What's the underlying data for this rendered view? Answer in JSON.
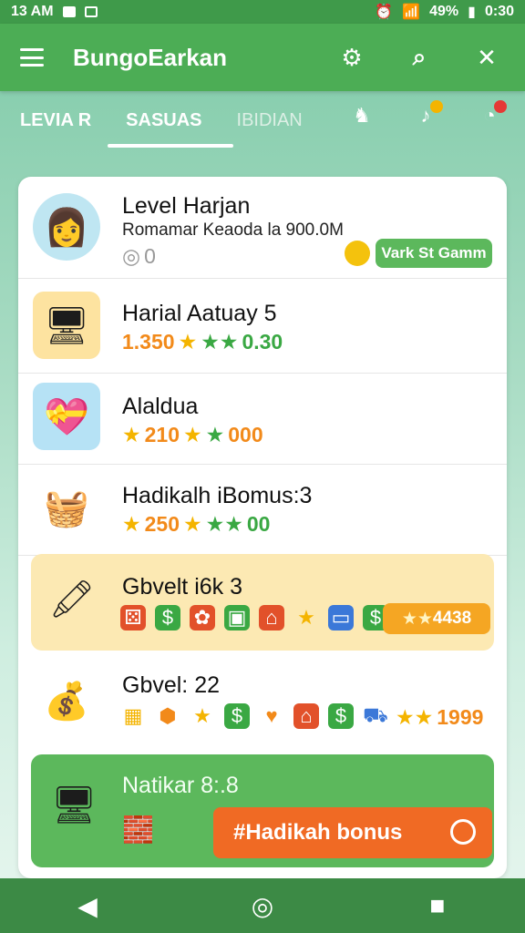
{
  "status": {
    "time_left": "13 AM",
    "battery": "49%",
    "clock": "0:30"
  },
  "app": {
    "title": "BungoEarkan"
  },
  "toolbar": {
    "settings_icon": "gear-icon",
    "search_icon": "search-icon",
    "close_icon": "close-icon"
  },
  "tabs": [
    {
      "label": "LEVIA R"
    },
    {
      "label": "SASUAS"
    },
    {
      "label": "IBIDIAN"
    }
  ],
  "rows": [
    {
      "title": "Level Harjan",
      "subtitle": "Romamar Keaoda la 900.0M",
      "stat": "0",
      "action": "Vark St Gamm"
    },
    {
      "title": "Harial Aatuay 5",
      "stat_a": "1.350",
      "stat_b": "0.30"
    },
    {
      "title": "Alaldua",
      "stat_a": "210",
      "stat_b": "000"
    },
    {
      "title": "Hadikalh iBomus:3",
      "stat_a": "250",
      "stat_b": "00"
    },
    {
      "title": "Gbvelt i6k 3",
      "badge": "4438"
    },
    {
      "title": "Gbvel: 22",
      "badge": "1999"
    },
    {
      "title": "Natikar 8:.8",
      "action": "#Hadikah bonus"
    }
  ],
  "colors": {
    "primary": "#4cad55",
    "accent": "#f06a24",
    "highlight": "#fce9b3"
  }
}
